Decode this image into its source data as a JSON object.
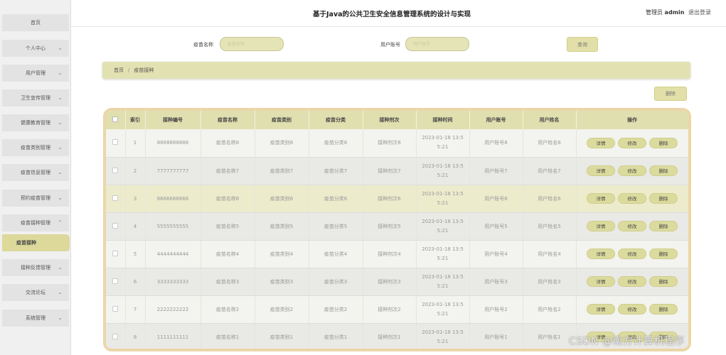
{
  "header": {
    "title": "基于Java的公共卫生安全信息管理系统的设计与实现",
    "user_role": "管理员",
    "user_name": "admin",
    "logout": "退出登录"
  },
  "sidebar": {
    "items": [
      {
        "label": "首页"
      },
      {
        "label": "个人中心"
      },
      {
        "label": "用户管理"
      },
      {
        "label": "卫生宣传管理"
      },
      {
        "label": "健康教育管理"
      },
      {
        "label": "疫苗类别管理"
      },
      {
        "label": "疫苗信息管理"
      },
      {
        "label": "预约疫苗管理"
      },
      {
        "label": "疫苗接种管理"
      },
      {
        "label": "疫苗接种"
      },
      {
        "label": "接种反馈管理"
      },
      {
        "label": "交流论坛"
      },
      {
        "label": "系统管理"
      }
    ]
  },
  "search": {
    "vaccine_name_label": "疫苗名称",
    "vaccine_name_placeholder": "疫苗名称",
    "account_label": "用户账号",
    "account_placeholder": "用户账号",
    "query_button": "查询"
  },
  "breadcrumb": {
    "home": "首页",
    "sep": "/",
    "current": "疫苗接种"
  },
  "toolbar": {
    "delete_label": "删除"
  },
  "table": {
    "headers": [
      "索引",
      "接种编号",
      "疫苗名称",
      "疫苗类别",
      "疫苗分类",
      "接种剂次",
      "接种时间",
      "用户账号",
      "用户姓名",
      "操作"
    ],
    "actions": {
      "detail": "详情",
      "edit": "修改",
      "delete": "删除"
    },
    "rows": [
      {
        "index": "1",
        "code": "8888888888",
        "name": "疫苗名称8",
        "category": "疫苗类别8",
        "classify": "疫苗分类8",
        "dose": "接种剂次8",
        "time_1": "2023-01-18 13:5",
        "time_2": "5:21",
        "account": "用户账号8",
        "username": "用户姓名8"
      },
      {
        "index": "2",
        "code": "7777777777",
        "name": "疫苗名称7",
        "category": "疫苗类别7",
        "classify": "疫苗分类7",
        "dose": "接种剂次7",
        "time_1": "2023-01-18 13:5",
        "time_2": "5:21",
        "account": "用户账号7",
        "username": "用户姓名7"
      },
      {
        "index": "3",
        "code": "6666666666",
        "name": "疫苗名称6",
        "category": "疫苗类别6",
        "classify": "疫苗分类6",
        "dose": "接种剂次6",
        "time_1": "2023-01-18 13:5",
        "time_2": "5:21",
        "account": "用户账号6",
        "username": "用户姓名6"
      },
      {
        "index": "4",
        "code": "5555555555",
        "name": "疫苗名称5",
        "category": "疫苗类别5",
        "classify": "疫苗分类5",
        "dose": "接种剂次5",
        "time_1": "2023-01-18 13:5",
        "time_2": "5:21",
        "account": "用户账号5",
        "username": "用户姓名5"
      },
      {
        "index": "5",
        "code": "4444444444",
        "name": "疫苗名称4",
        "category": "疫苗类别4",
        "classify": "疫苗分类4",
        "dose": "接种剂次4",
        "time_1": "2023-01-18 13:5",
        "time_2": "5:21",
        "account": "用户账号4",
        "username": "用户姓名4"
      },
      {
        "index": "6",
        "code": "3333333333",
        "name": "疫苗名称3",
        "category": "疫苗类别3",
        "classify": "疫苗分类3",
        "dose": "接种剂次3",
        "time_1": "2023-01-18 13:5",
        "time_2": "5:21",
        "account": "用户账号3",
        "username": "用户姓名3"
      },
      {
        "index": "7",
        "code": "2222222222",
        "name": "疫苗名称2",
        "category": "疫苗类别2",
        "classify": "疫苗分类2",
        "dose": "接种剂次2",
        "time_1": "2023-01-18 13:5",
        "time_2": "5:21",
        "account": "用户账号2",
        "username": "用户姓名2"
      },
      {
        "index": "8",
        "code": "1111111111",
        "name": "疫苗名称1",
        "category": "疫苗类别1",
        "classify": "疫苗分类1",
        "dose": "接种剂次1",
        "time_1": "2023-01-18 13:5",
        "time_2": "5:21",
        "account": "用户账号1",
        "username": "用户姓名1"
      }
    ]
  },
  "watermark": "CSDN @南方计算机程序"
}
